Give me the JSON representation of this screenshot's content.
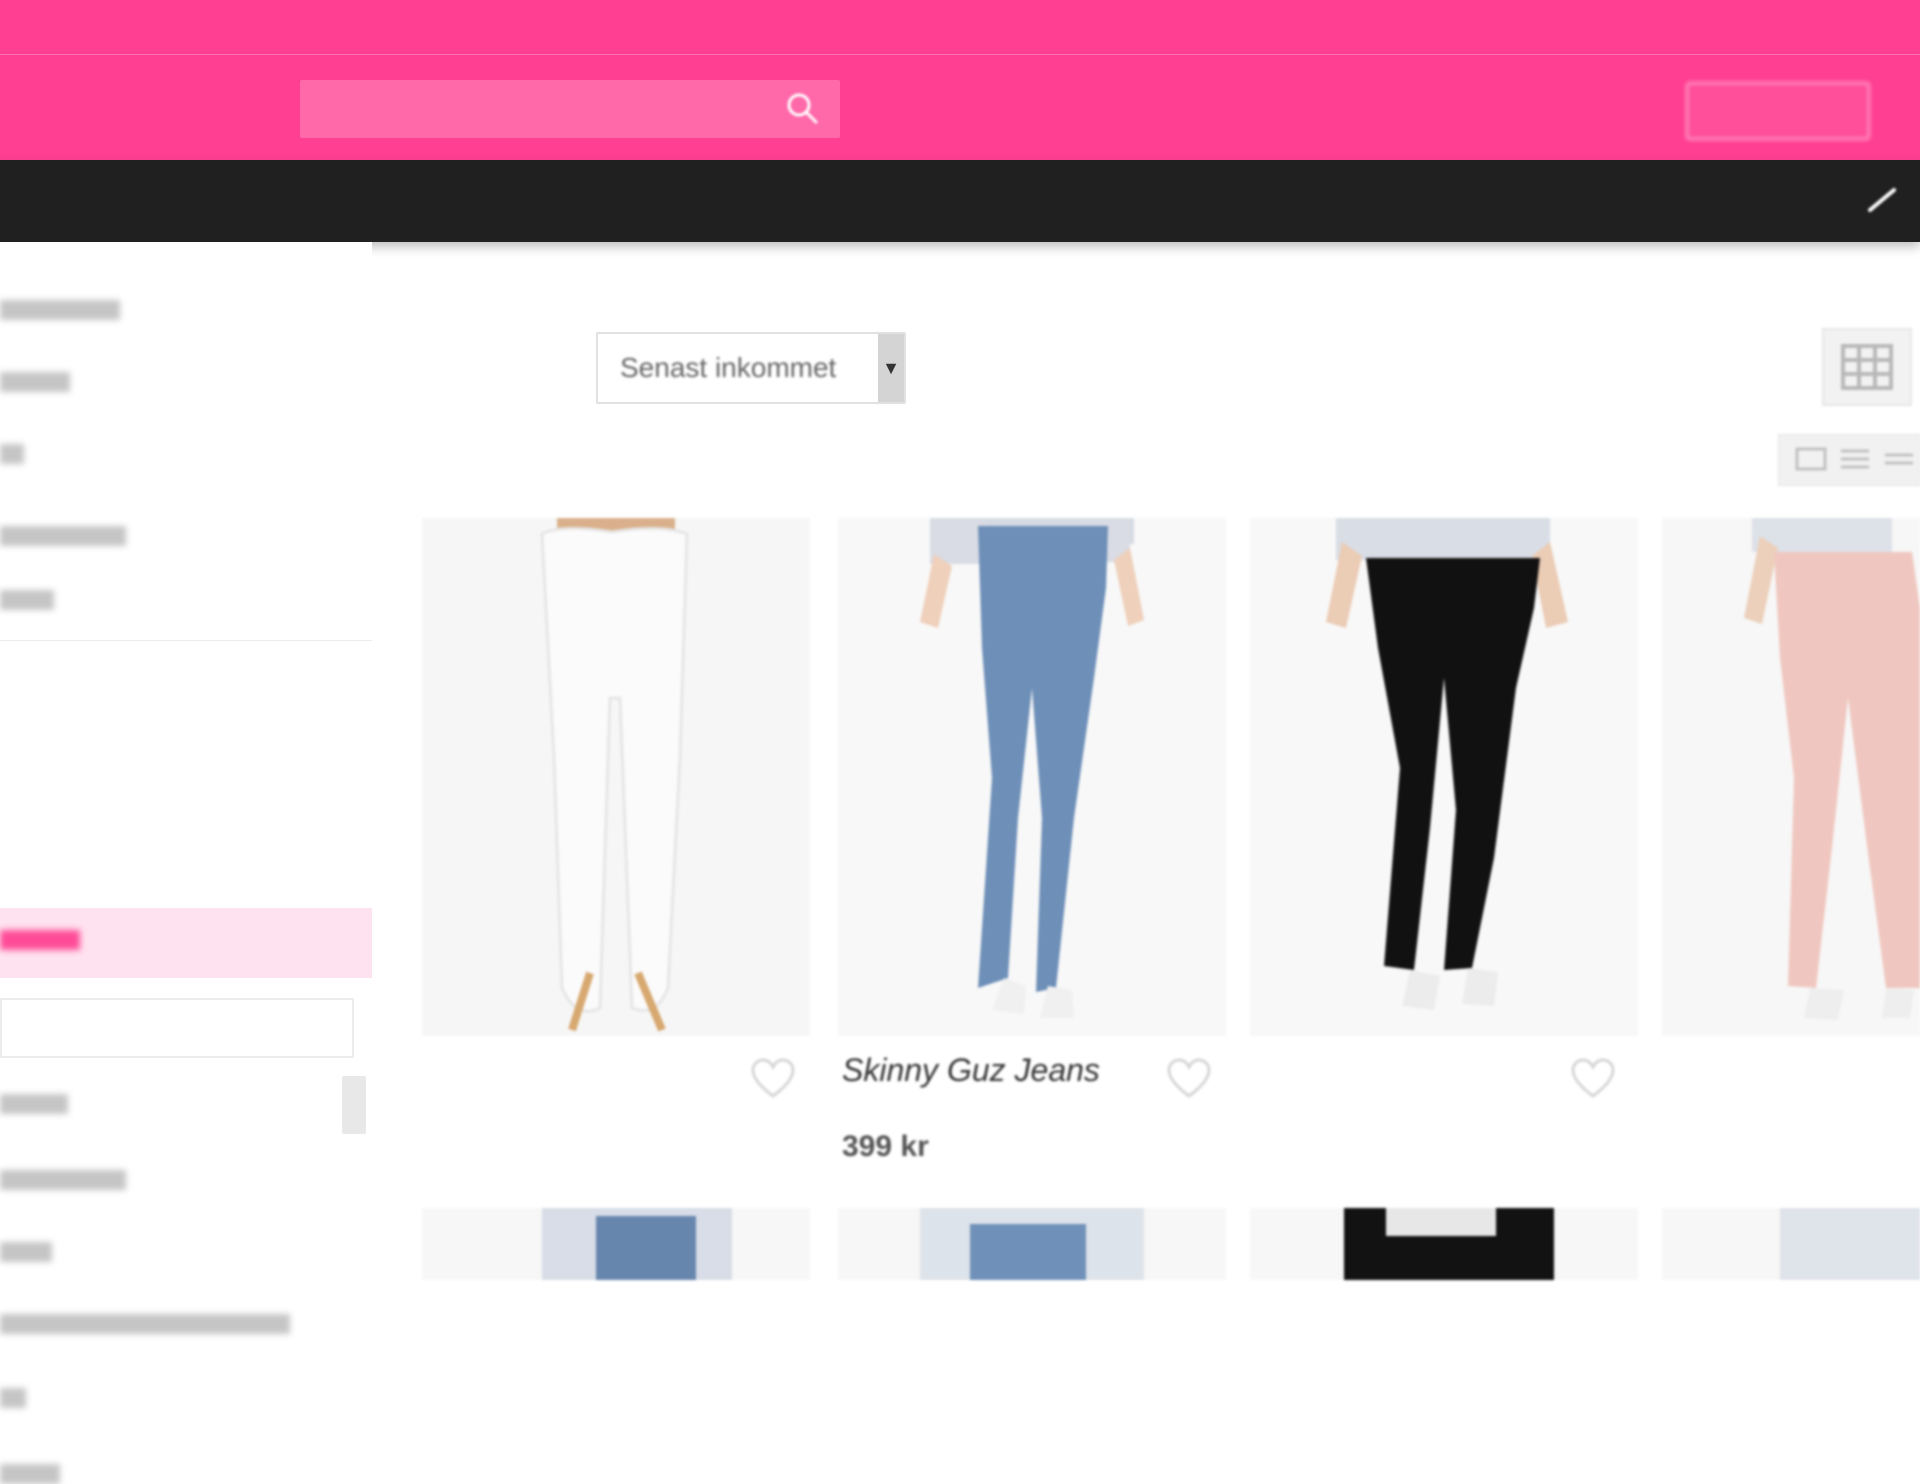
{
  "header": {
    "top_left_link": "",
    "top_right_text": "",
    "logo": "",
    "search_placeholder": "",
    "account_label": ""
  },
  "nav": {
    "items": [
      {
        "label": ""
      },
      {
        "label": ""
      },
      {
        "label": ""
      },
      {
        "label": ""
      },
      {
        "label": ""
      }
    ]
  },
  "listing": {
    "count": "",
    "sort_label": "",
    "sort_value": "Senast inkommet"
  },
  "products": [
    {
      "title": "",
      "brand": "",
      "price": "",
      "image": "white-jeans",
      "heart_icon": "heart-icon"
    },
    {
      "title": "Skinny Guz Jeans",
      "brand": "",
      "price": "399 kr",
      "image": "blue-jeans",
      "heart_icon": "heart-icon"
    },
    {
      "title": "",
      "brand": "",
      "price": "",
      "image": "black-jeans",
      "heart_icon": "heart-icon"
    },
    {
      "title": "",
      "brand": "",
      "price": "",
      "image": "pink-jeans",
      "heart_icon": "heart-icon"
    }
  ],
  "icons": {
    "search": "search-icon",
    "nav_arrow": "chevron-right-icon",
    "grid_large": "grid-icon",
    "grid_small": "view-icon"
  },
  "colors": {
    "brand_pink": "#ff3f92",
    "nav_black": "#202020",
    "sidebar_highlight": "#ffe2ef"
  }
}
